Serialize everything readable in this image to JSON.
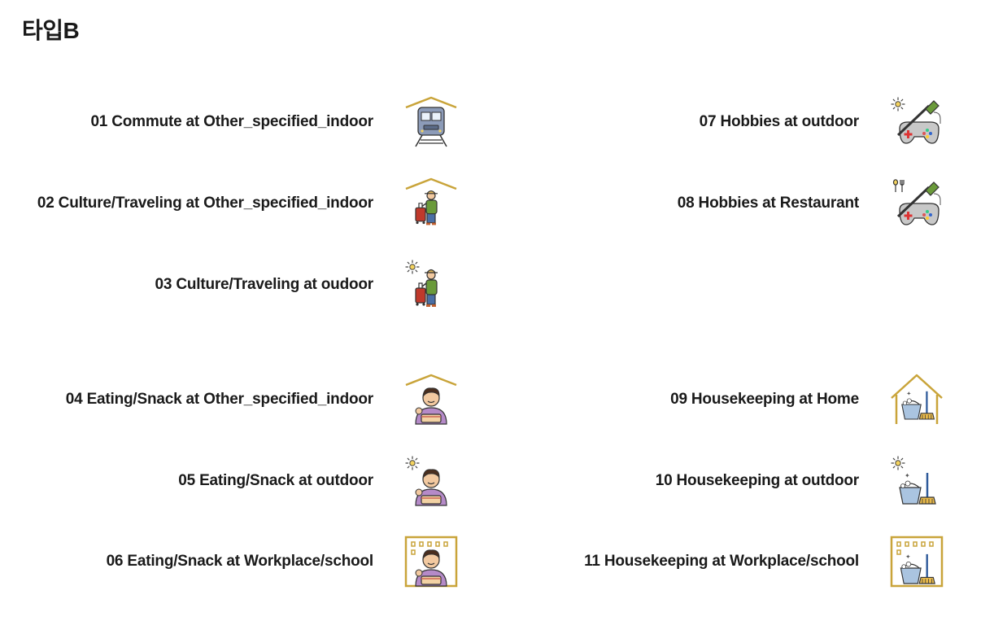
{
  "title": "타입B",
  "left_items": [
    {
      "label": "01 Commute at Other_specified_indoor",
      "icon": "train-under-roof-icon"
    },
    {
      "label": "02 Culture/Traveling at Other_specified_indoor",
      "icon": "traveler-under-roof-icon"
    },
    {
      "label": "03 Culture/Traveling at oudoor",
      "icon": "traveler-outdoor-sun-icon"
    },
    {
      "label": "04 Eating/Snack at Other_specified_indoor",
      "icon": "eating-under-roof-icon"
    },
    {
      "label": "05 Eating/Snack at outdoor",
      "icon": "eating-outdoor-sun-icon"
    },
    {
      "label": "06 Eating/Snack at Workplace/school",
      "icon": "eating-in-building-icon"
    }
  ],
  "right_items": [
    {
      "label": "07 Hobbies at outdoor",
      "icon": "hobby-gamepad-brush-sun-icon"
    },
    {
      "label": "08 Hobbies at Restaurant",
      "icon": "hobby-gamepad-brush-cutlery-icon"
    },
    {
      "label": "09 Housekeeping at Home",
      "icon": "cleaning-in-house-icon"
    },
    {
      "label": "10 Housekeeping at outdoor",
      "icon": "cleaning-outdoor-sun-icon"
    },
    {
      "label": "11 Housekeeping at Workplace/school",
      "icon": "cleaning-in-building-icon"
    }
  ]
}
